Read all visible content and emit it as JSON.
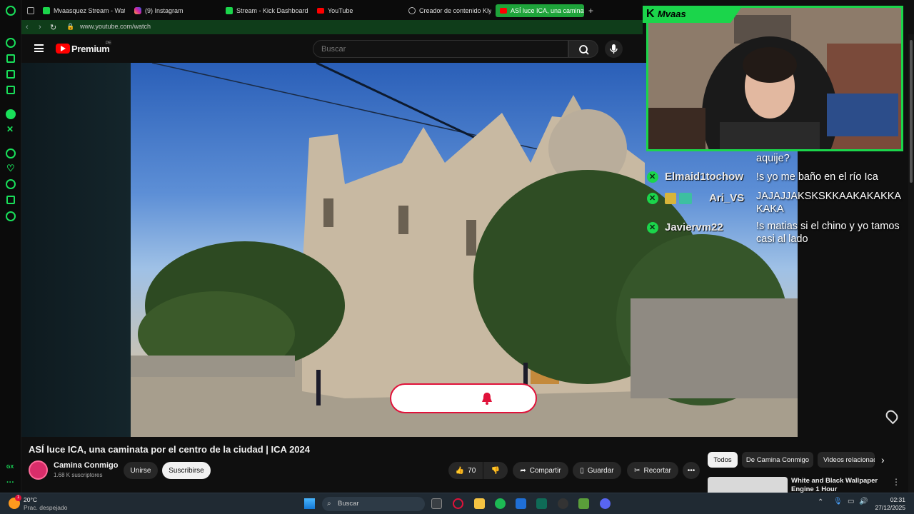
{
  "browser": {
    "url": "www.youtube.com/watch",
    "tabs": [
      {
        "label": "Mvaasquez Stream - Wat",
        "icon": "kick-icon"
      },
      {
        "label": "(9) Instagram",
        "icon": "instagram-icon"
      },
      {
        "label": "Stream - Kick Dashboard",
        "icon": "kick-icon"
      },
      {
        "label": "YouTube",
        "icon": "youtube-icon"
      },
      {
        "label": "Creador de contenido Kly",
        "icon": "globe-icon"
      },
      {
        "label": "ASÍ luce ICA, una caminat",
        "icon": "youtube-icon",
        "active": true
      }
    ],
    "new_tab": "+",
    "accent": "#1bd54b",
    "rail_labels": {
      "gx": "GX",
      "more": "···"
    }
  },
  "youtube": {
    "logo_text": "Premium",
    "region": "PE",
    "search_placeholder": "Buscar",
    "video_title": "ASÍ luce ICA, una caminata por el centro de la ciudad | ICA 2024",
    "channel": {
      "name": "Camina Conmigo",
      "subscribers": "1.68 K suscriptores"
    },
    "buttons": {
      "join": "Unirse",
      "subscribe": "Suscribirse",
      "likes": "70",
      "share": "Compartir",
      "save": "Guardar",
      "clip": "Recortar"
    },
    "chips": [
      "Todos",
      "De Camina Conmigo",
      "Videos relacionados"
    ],
    "related": {
      "title": "White and Black Wallpaper Engine 1 Hour"
    }
  },
  "overlay": {
    "streamer": "Mvaas",
    "chat": [
      {
        "user": "",
        "message": "aquije?"
      },
      {
        "user": "Elmaid1tochow",
        "message": "!s yo me baño en el río Ica"
      },
      {
        "user": "Ari_VS",
        "message": "JAJAJJAKSKSKKAAKAKAKKAKAKA"
      },
      {
        "user": "Javiervm22",
        "message": "!s matias si el chino y yo tamos casi al lado"
      }
    ]
  },
  "taskbar": {
    "temperature": "20°C",
    "weather": "Prac. despejado",
    "search": "Buscar",
    "time": "02:31",
    "date": "27/12/2025",
    "notification_count": "1"
  }
}
